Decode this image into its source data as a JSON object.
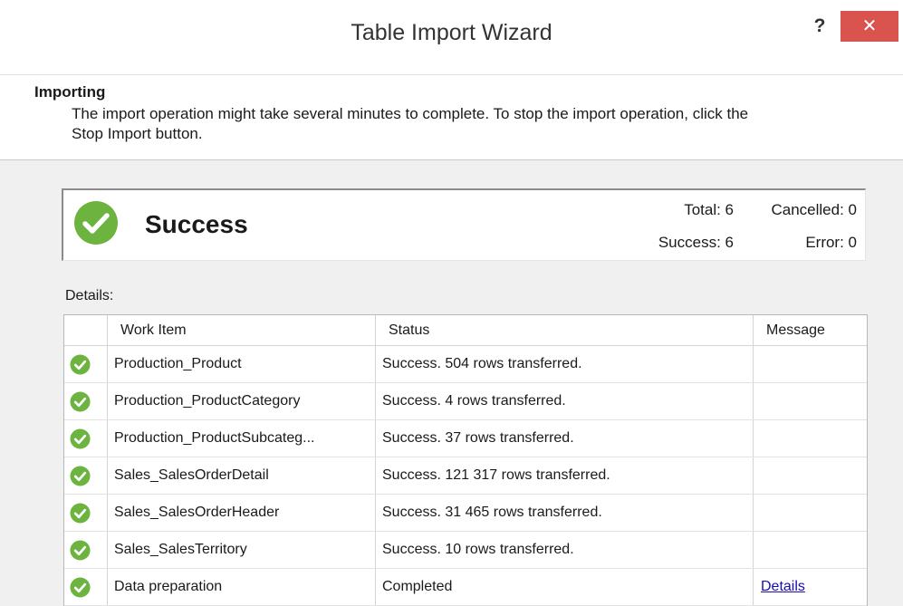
{
  "window": {
    "title": "Table Import Wizard",
    "help_label": "?",
    "close_label": "✕"
  },
  "header": {
    "title": "Importing",
    "description": "The import operation might take several minutes to complete. To stop the import operation, click the Stop Import button."
  },
  "summary": {
    "status": "Success",
    "status_icon": "check-circle-icon",
    "total": "Total: 6",
    "cancelled": "Cancelled: 0",
    "success": "Success: 6",
    "error": "Error: 0"
  },
  "details": {
    "label": "Details:",
    "columns": {
      "work_item": "Work Item",
      "status": "Status",
      "message": "Message"
    },
    "rows": [
      {
        "work_item": "Production_Product",
        "status": "Success. 504 rows transferred.",
        "message": ""
      },
      {
        "work_item": "Production_ProductCategory",
        "status": "Success. 4 rows transferred.",
        "message": ""
      },
      {
        "work_item": "Production_ProductSubcateg...",
        "status": "Success. 37 rows transferred.",
        "message": ""
      },
      {
        "work_item": "Sales_SalesOrderDetail",
        "status": "Success. 121 317 rows transferred.",
        "message": ""
      },
      {
        "work_item": "Sales_SalesOrderHeader",
        "status": "Success. 31 465 rows transferred.",
        "message": ""
      },
      {
        "work_item": "Sales_SalesTerritory",
        "status": "Success. 10 rows transferred.",
        "message": ""
      },
      {
        "work_item": "Data preparation",
        "status": "Completed",
        "message": "Details"
      }
    ]
  },
  "colors": {
    "success_green": "#6cb33f",
    "close_red": "#d9534f",
    "link_blue": "#1a0dab"
  }
}
